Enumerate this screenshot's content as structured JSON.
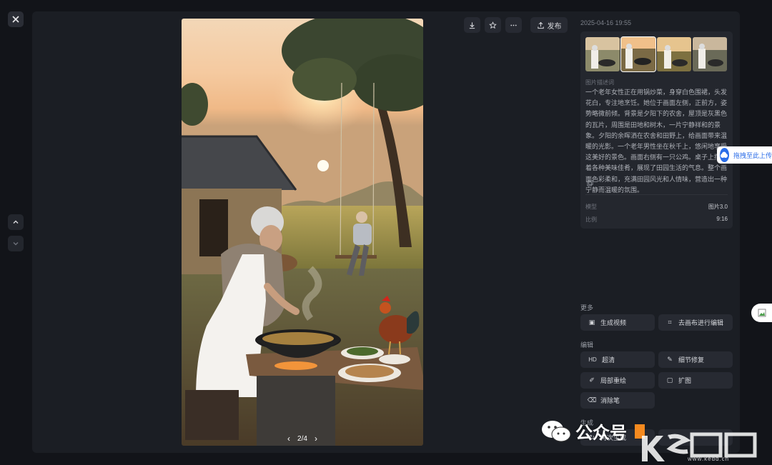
{
  "toolbar": {
    "download_icon": "download-icon",
    "favorite_icon": "star-icon",
    "more_icon": "more-icon",
    "publish_label": "发布"
  },
  "viewer": {
    "counter": "2/4"
  },
  "info": {
    "timestamp": "2025-04-16 19:55",
    "description_label": "图片描述词",
    "description": "一个老年女性正在用锅炒菜，身穿白色围裙，头发花白，专注地烹饪。她位于画面左侧，正前方，姿势略微前倾。背景是夕阳下的农舍，屋顶是灰黑色的瓦片，周围是田地和树木，一片宁静祥和的景象。夕阳的余晖洒在农舍和田野上，给画面带来温暖的光影。一个老年男性坐在秋千上，悠闲地享受这美好的景色。画面右侧有一只公鸡。桌子上摆放着各种美味佳肴，展现了田园生活的气息。整个画面色彩柔和，充满田园风光和人情味，营造出一种宁静而温暖的氛围。",
    "model_label": "模型",
    "model_value": "图片3.0",
    "ratio_label": "比例",
    "ratio_value": "9:16"
  },
  "sections": {
    "more": "更多",
    "edit": "编辑",
    "generate": "生成"
  },
  "actions": {
    "generate_video": "生成视频",
    "canvas_edit": "去画布进行编辑",
    "hd": "超清",
    "hd_badge": "HD",
    "detail_fix": "细节修复",
    "partial_redraw": "局部重绘",
    "expand": "扩图",
    "eraser": "消除笔",
    "regenerate": "再次生成"
  },
  "overlay": {
    "drag_hint": "拖拽至此上传",
    "watermark_text": "公众号",
    "site_url": "www.kedd.cn"
  },
  "colors": {
    "background": "#121419",
    "panel": "#1b1e24",
    "card": "#24272e",
    "button": "#272a32",
    "accent_blue": "#2b6de8",
    "accent_orange": "#f58a1f"
  }
}
